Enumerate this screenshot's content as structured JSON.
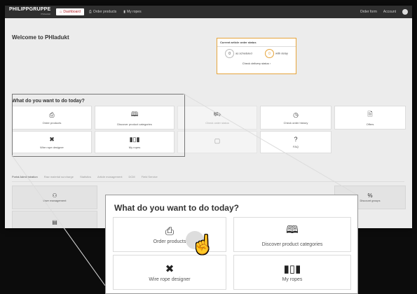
{
  "header": {
    "logo_main": "PHILIPPGRUPPE",
    "logo_sub": "PHIadukt",
    "nav": [
      "Dashboard",
      "Order products",
      "My ropes"
    ],
    "order_form": "Order form",
    "account": "Account"
  },
  "welcome": "Welcome to PHIadukt",
  "status": {
    "title": "Current article order status",
    "as_scheduled": "as scheduled",
    "with_delay": "with delay",
    "check": "Check delivery status ›"
  },
  "question": "What do you want to do today?",
  "tiles": [
    {
      "label": "Order products",
      "icon": "clipboard-icon",
      "glyph": "⎙"
    },
    {
      "label": "Discover product categories",
      "icon": "book-icon",
      "glyph": "🕮"
    },
    {
      "label": "Check order status",
      "icon": "truck-icon",
      "glyph": "⛟"
    },
    {
      "label": "Check order history",
      "icon": "clock-icon",
      "glyph": "◷"
    },
    {
      "label": "Offers",
      "icon": "document-icon",
      "glyph": "🗎"
    },
    {
      "label": "Wire rope designer",
      "icon": "tools-icon",
      "glyph": "✖"
    },
    {
      "label": "My ropes",
      "icon": "barcode-icon",
      "glyph": "▮▯▮"
    },
    {
      "label": "FAQ",
      "icon": "question-icon",
      "glyph": "?"
    }
  ],
  "admin_tabs": [
    "Portal Administration",
    "Raw material surcharge",
    "Statistics",
    "Article management",
    "DCM",
    "Field Service"
  ],
  "admin_tiles": [
    {
      "label": "User management",
      "icon": "users-icon",
      "glyph": "⚇"
    },
    {
      "label": "Discount groups",
      "icon": "percent-icon",
      "glyph": "%"
    }
  ],
  "zoom": {
    "question": "What do you want to do today?",
    "order_products": "Order products",
    "discover": "Discover product categories",
    "wire_rope": "Wire rope designer",
    "my_ropes": "My ropes"
  }
}
